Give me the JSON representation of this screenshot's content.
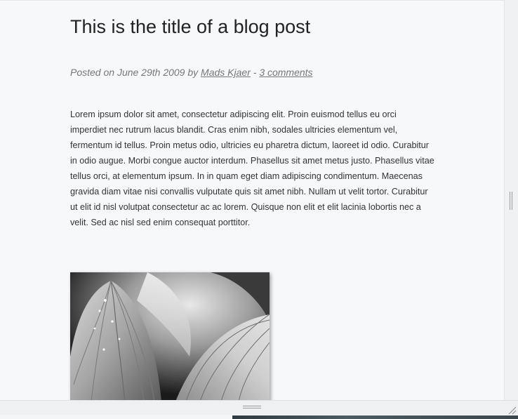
{
  "post": {
    "title": "This is the title of a blog post",
    "meta": {
      "posted_on": "Posted on June 29th 2009 by ",
      "author": "Mads Kjaer",
      "separator": " - ",
      "comments": "3 comments"
    },
    "body": "Lorem ipsum dolor sit amet, consectetur adipiscing elit. Proin euismod tellus eu orci imperdiet nec rutrum lacus blandit. Cras enim nibh, sodales ultricies elementum vel, fermentum id tellus. Proin metus odio, ultricies eu pharetra dictum, laoreet id odio. Curabitur in odio augue. Morbi congue auctor interdum. Phasellus sit amet metus justo. Phasellus vitae tellus orci, at elementum ipsum. In in quam eget diam adipiscing condimentum. Maecenas gravida diam vitae nisi convallis vulputate quis sit amet nibh. Nullam ut velit tortor. Curabitur ut elit id nisl volutpat consectetur ac ac lorem. Quisque non elit et elit lacinia lobortis nec a velit. Sed ac nisl sed enim consequat porttitor.",
    "image": {
      "icon": "flower-petal-photo"
    }
  },
  "panes": {
    "vertical_splitter_icon": "drag-handle-vertical",
    "horizontal_splitter_icon": "drag-handle-horizontal",
    "resize_icon": "resize-grip"
  },
  "colors": {
    "link": "#777777",
    "title": "#222222",
    "body_text": "#333333",
    "background": "#f7f8fa"
  }
}
